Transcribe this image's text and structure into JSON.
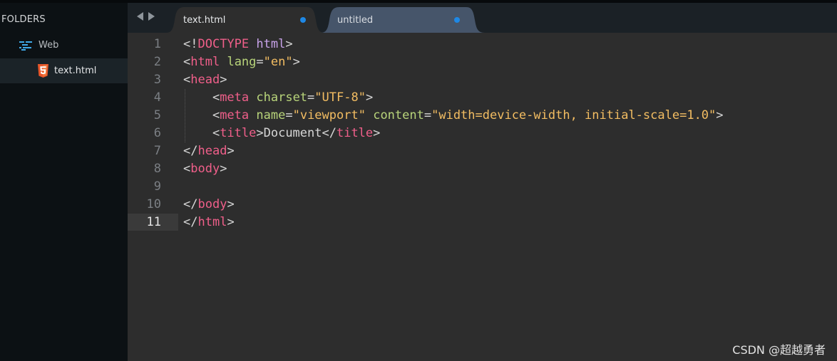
{
  "sidebar": {
    "title": "FOLDERS",
    "folder": {
      "name": "Web",
      "icon": "folder-tree-icon"
    },
    "file": {
      "name": "text.html",
      "icon": "html5-icon"
    }
  },
  "tabs": [
    {
      "label": "text.html",
      "active": true,
      "modified": true
    },
    {
      "label": "untitled",
      "active": false,
      "modified": true
    }
  ],
  "editor": {
    "active_line": 11,
    "line_numbers": [
      "1",
      "2",
      "3",
      "4",
      "5",
      "6",
      "7",
      "8",
      "9",
      "10",
      "11"
    ],
    "lines": [
      [
        [
          "t",
          "<!"
        ],
        [
          "doctype",
          "DOCTYPE"
        ],
        [
          "t",
          " "
        ],
        [
          "kw",
          "html"
        ],
        [
          "t",
          ">"
        ]
      ],
      [
        [
          "t",
          "<"
        ],
        [
          "tag",
          "html"
        ],
        [
          "t",
          " "
        ],
        [
          "attr",
          "lang"
        ],
        [
          "t",
          "="
        ],
        [
          "str",
          "\"en\""
        ],
        [
          "t",
          ">"
        ]
      ],
      [
        [
          "t",
          "<"
        ],
        [
          "tag",
          "head"
        ],
        [
          "t",
          ">"
        ]
      ],
      [
        [
          "t",
          "    <"
        ],
        [
          "tag",
          "meta"
        ],
        [
          "t",
          " "
        ],
        [
          "attr",
          "charset"
        ],
        [
          "t",
          "="
        ],
        [
          "str",
          "\"UTF-8\""
        ],
        [
          "t",
          ">"
        ]
      ],
      [
        [
          "t",
          "    <"
        ],
        [
          "tag",
          "meta"
        ],
        [
          "t",
          " "
        ],
        [
          "attr",
          "name"
        ],
        [
          "t",
          "="
        ],
        [
          "str",
          "\"viewport\""
        ],
        [
          "t",
          " "
        ],
        [
          "attr",
          "content"
        ],
        [
          "t",
          "="
        ],
        [
          "str",
          "\"width=device-width, initial-scale=1.0\""
        ],
        [
          "t",
          ">"
        ]
      ],
      [
        [
          "t",
          "    <"
        ],
        [
          "tag",
          "title"
        ],
        [
          "t",
          ">Document</"
        ],
        [
          "tag",
          "title"
        ],
        [
          "t",
          ">"
        ]
      ],
      [
        [
          "t",
          "</"
        ],
        [
          "tag",
          "head"
        ],
        [
          "t",
          ">"
        ]
      ],
      [
        [
          "t",
          "<"
        ],
        [
          "tag",
          "body"
        ],
        [
          "t",
          ">"
        ]
      ],
      [
        [
          "t",
          ""
        ]
      ],
      [
        [
          "t",
          "</"
        ],
        [
          "tag",
          "body"
        ],
        [
          "t",
          ">"
        ]
      ],
      [
        [
          "t",
          "</"
        ],
        [
          "tag",
          "html"
        ],
        [
          "t",
          ">"
        ]
      ]
    ]
  },
  "watermark": "CSDN @超越勇者",
  "colors": {
    "accent_dot": "#1e88e5",
    "tag": "#f05f8a",
    "attribute": "#b8d47a",
    "string": "#f3bd62",
    "keyword": "#c7a2e8"
  }
}
